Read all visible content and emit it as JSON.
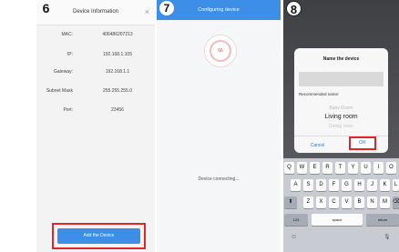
{
  "panel6": {
    "step": "6",
    "title": "Device Information",
    "close": "×",
    "rows": [
      {
        "label": "MAC:",
        "value": "406486207213"
      },
      {
        "label": "IP:",
        "value": "192.168.1.105"
      },
      {
        "label": "Gateway:",
        "value": "192.168.1.1"
      },
      {
        "label": "Subnet Mask",
        "value": "255.255.255.0"
      },
      {
        "label": "Port:",
        "value": "23456"
      }
    ],
    "add_button": "Add the Device"
  },
  "panel7": {
    "step": "7",
    "title": "Configuring device",
    "progress": "66",
    "status": "Device connecting..."
  },
  "panel8": {
    "step": "8",
    "dialog_title": "Name the device",
    "recommended_label": "Recommended name:",
    "picker": [
      "Baby Room",
      "Living room",
      "Dining room"
    ],
    "cancel": "Cancel",
    "ok": "OK",
    "keyboard": {
      "row1": [
        "Q",
        "W",
        "E",
        "R",
        "T",
        "Y",
        "U",
        "I",
        "O"
      ],
      "row2": [
        "A",
        "S",
        "D",
        "F",
        "G",
        "H",
        "J",
        "K",
        "L"
      ],
      "row3": [
        "Z",
        "X",
        "C",
        "V",
        "B",
        "N",
        "M"
      ],
      "shift": "⬆",
      "delete": "⌫",
      "numbers": "123",
      "space": "space",
      "return": "return",
      "emoji": "☺",
      "mic": "🎙"
    }
  }
}
